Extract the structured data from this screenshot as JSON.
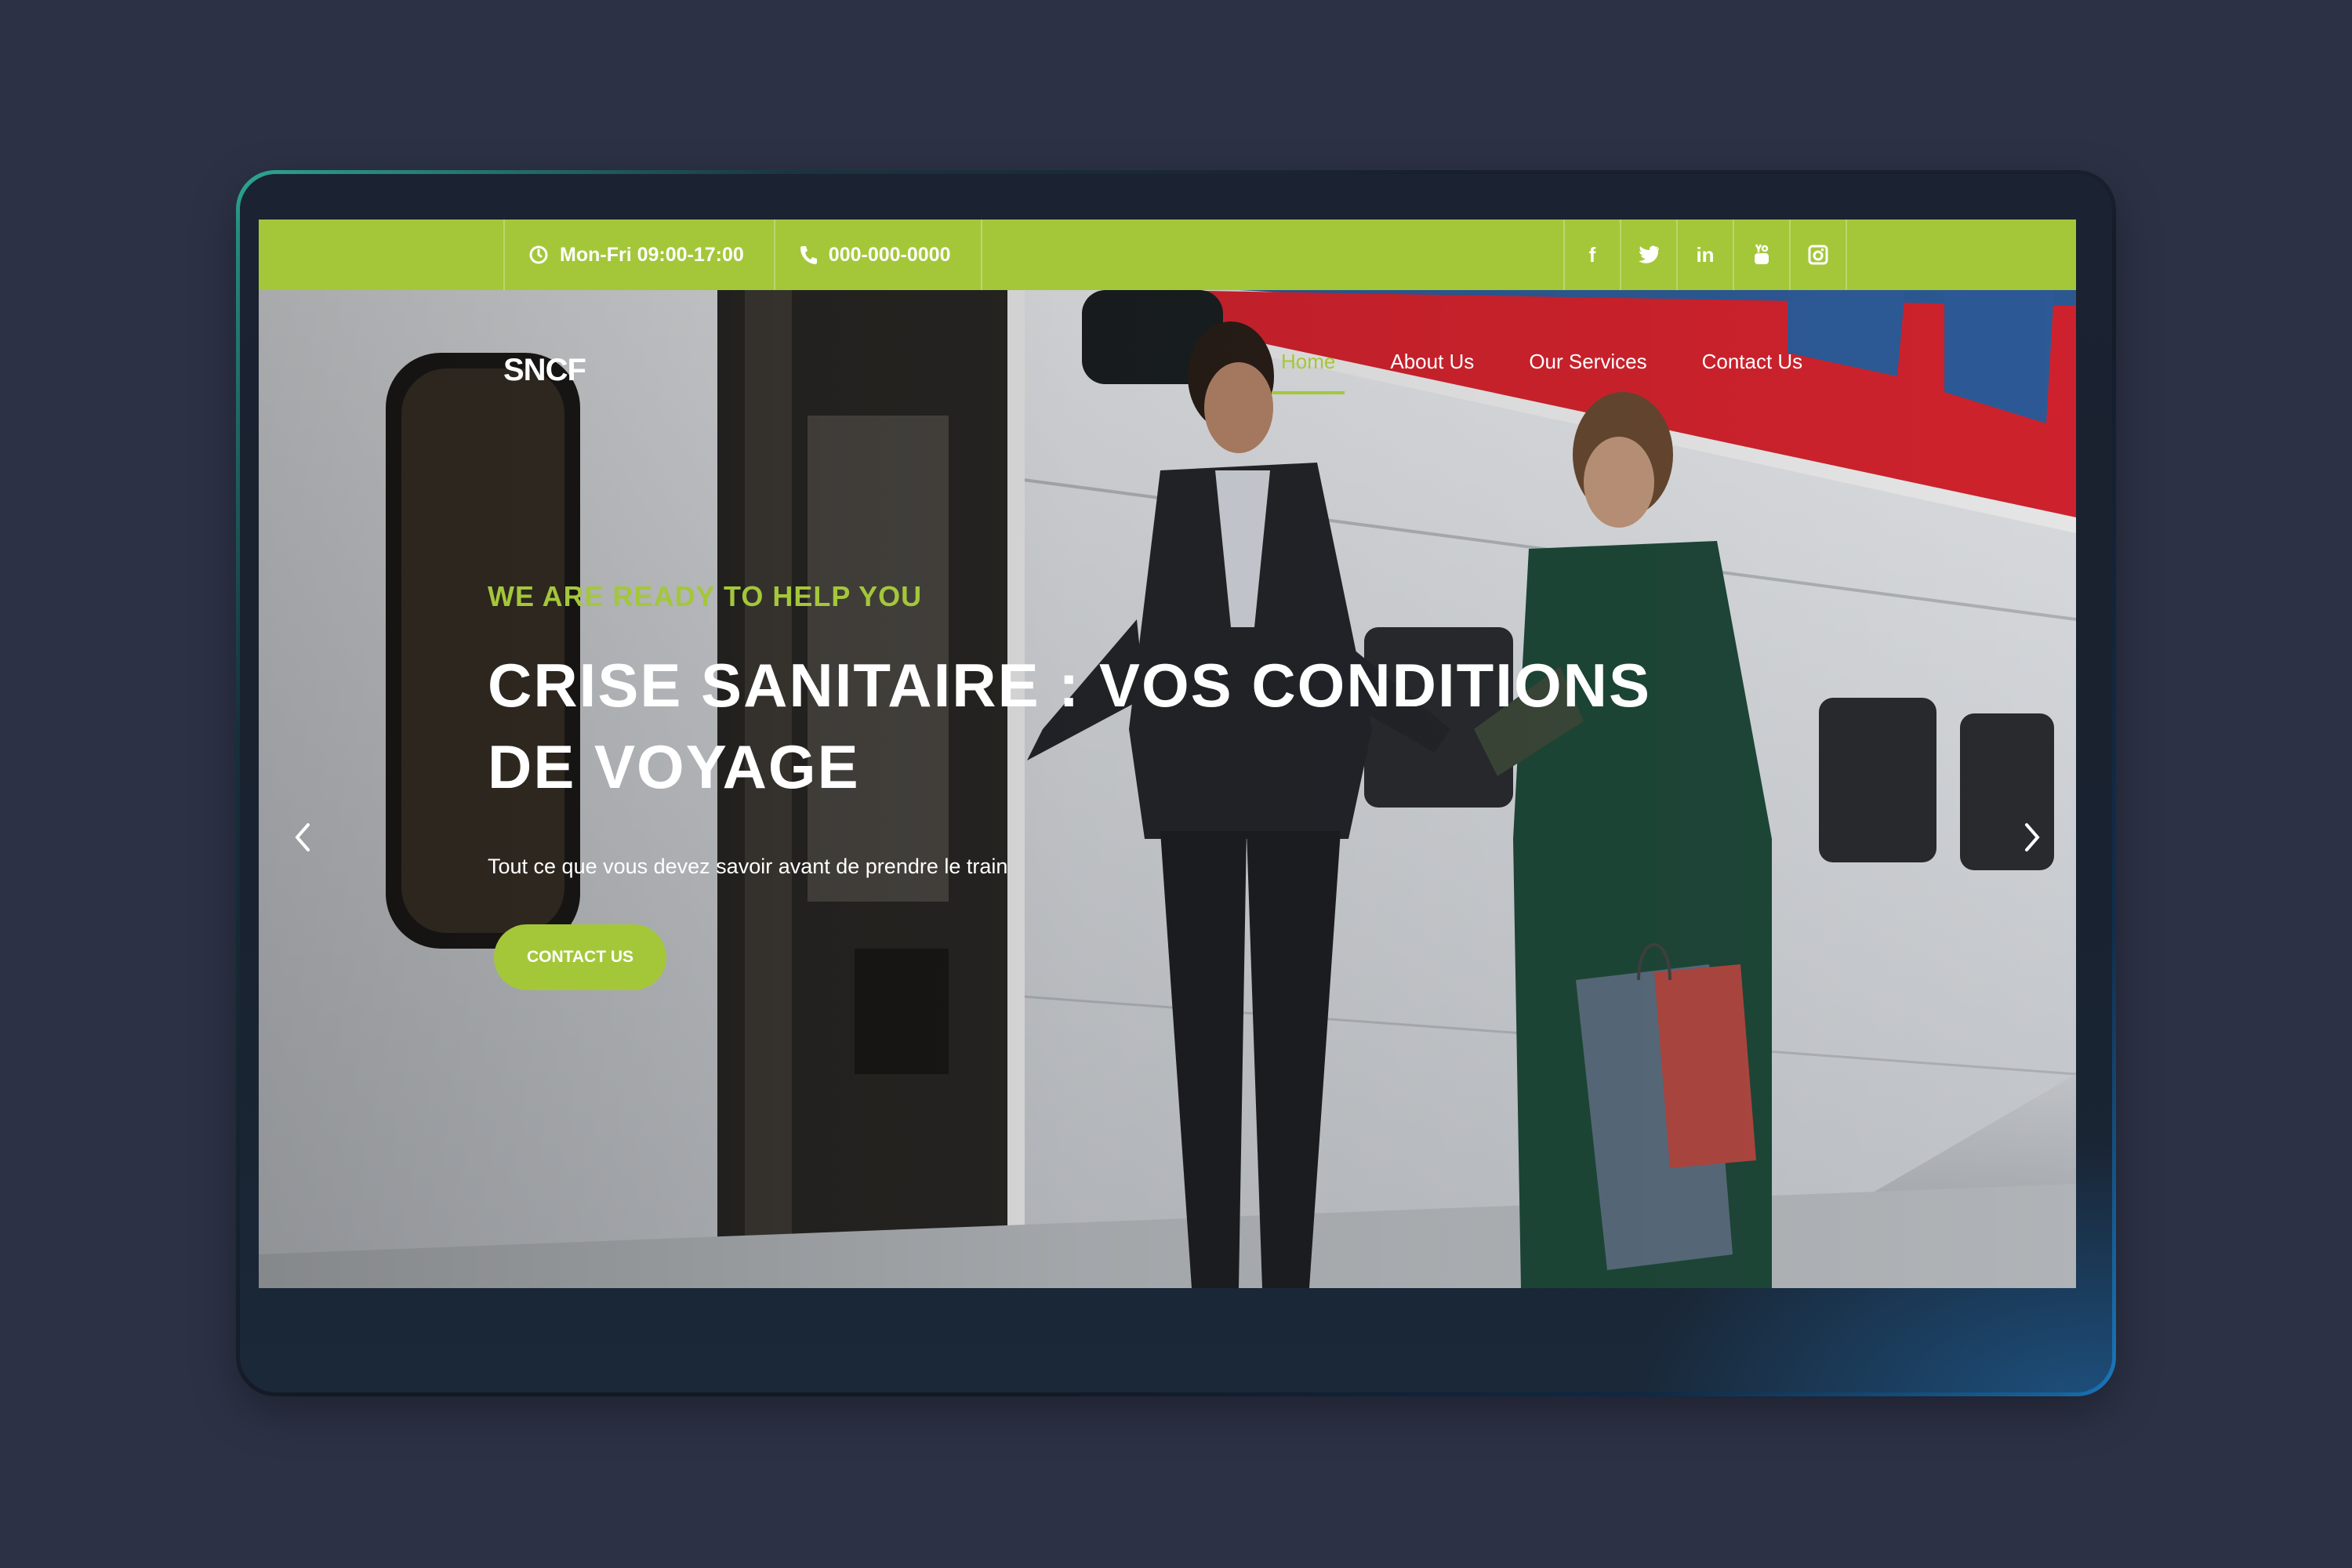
{
  "topbar": {
    "hours": "Mon-Fri 09:00-17:00",
    "phone": "000-000-0000",
    "social": [
      "facebook-icon",
      "twitter-icon",
      "linkedin-icon",
      "youtube-icon",
      "instagram-icon"
    ],
    "social_labels": {
      "facebook": "f",
      "linkedin": "in"
    }
  },
  "nav": {
    "logo": "SNCF",
    "items": [
      "Home",
      "About Us",
      "Our Services",
      "Contact Us"
    ],
    "active": "Home"
  },
  "hero": {
    "kicker": "WE ARE READY TO HELP YOU",
    "headline": "CRISE SANITAIRE : VOS CONDITIONS DE VOYAGE",
    "subtitle": "Tout ce que vous devez savoir avant de prendre le train",
    "cta": "CONTACT US"
  },
  "colors": {
    "accent": "#a4c73a",
    "background": "#2c3145",
    "frame": "#1a2231"
  }
}
